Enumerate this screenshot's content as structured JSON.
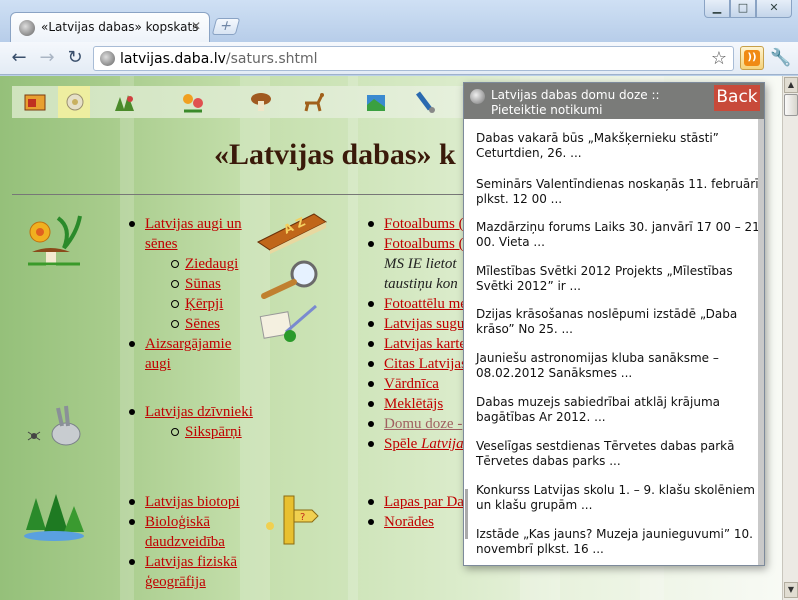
{
  "browser": {
    "tab_title": "«Latvijas dabas» kopskats",
    "tab_close": "✕",
    "url_domain": "latvijas.daba.lv",
    "url_path": "/saturs.shtml"
  },
  "page": {
    "title": "«Latvijas dabas» k",
    "col1": [
      {
        "text": "Latvijas augi un sēnes",
        "level": "top"
      },
      {
        "text": "Ziedaugi",
        "level": "sub"
      },
      {
        "text": "Sūnas",
        "level": "sub"
      },
      {
        "text": "Ķērpji",
        "level": "sub"
      },
      {
        "text": "Sēnes",
        "level": "sub"
      },
      {
        "text": "Aizsargājamie augi",
        "level": "top"
      }
    ],
    "col1b": [
      {
        "text": "Latvijas dzīvnieki",
        "level": "top"
      },
      {
        "text": "Sikspārņi",
        "level": "sub"
      }
    ],
    "col1c": [
      {
        "text": "Latvijas biotopi",
        "level": "top"
      },
      {
        "text": "Bioloģiskā daudzveidība",
        "level": "top"
      },
      {
        "text": "Latvijas fiziskā ģeogrāfija",
        "level": "top"
      }
    ],
    "col2": {
      "fotoalbums_1": "Fotoalbums (",
      "fotoalbums_2": "Fotoalbums (",
      "ms_line1": "MS IE lietot",
      "ms_line2": "taustiņu kon",
      "fotoattelu": "Fotoattēlu me",
      "sugu": "Latvijas sugu",
      "kartes": "Latvijas karte",
      "citas": "Citas Latvijas",
      "vardnica": "Vārdnīca",
      "mekletajs": "Meklētājs",
      "domu_doze": "Domu doze -",
      "spele_a": "Spēle ",
      "spele_b": "Latvija",
      "lapas": "Lapas par Da",
      "norades": "Norādes"
    }
  },
  "popup": {
    "title": "Latvijas dabas domu doze :: Pieteiktie notikumi",
    "back_label": "Back",
    "items": [
      "Dabas vakarā būs „Makšķernieku stāsti” Ceturtdien, 26. ...",
      "Seminārs Valentīndienas noskaņās 11. februārī plkst. 12 00 ...",
      "Mazdārziņu forums Laiks 30. janvārī 17 00 – 21 00. Vieta ...",
      "Mīlestības Svētki 2012 Projekts „Mīlestības Svētki 2012” ir ...",
      "Dzijas krāsošanas noslēpumi izstādē „Daba krāso” No 25. ...",
      "Jauniešu astronomijas kluba sanāksme – 08.02.2012 Sanāksmes ...",
      "Dabas muzejs sabiedrībai atklāj krājuma bagātības Ar 2012. ...",
      "Veselīgas sestdienas Tērvetes dabas parkā Tērvetes dabas parks ...",
      "Konkurss Latvijas skolu 1. – 9. klašu skolēniem un klašu grupām ...",
      "Izstāde „Kas jauns? Muzeja jaunieguvumi” 10. novembrī plkst. 16 ..."
    ]
  },
  "colors": {
    "link": "#c00000",
    "popup_header": "#7a7b79",
    "back_button": "#c84a3a",
    "title": "#3a1a0a"
  }
}
